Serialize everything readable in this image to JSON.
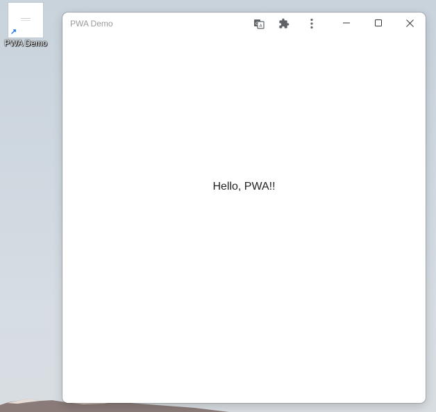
{
  "desktop": {
    "shortcut_label": "PWA Demo",
    "icon": "app-shortcut-icon"
  },
  "window": {
    "title": "PWA Demo",
    "toolbar_icons": [
      "translate-icon",
      "extensions-icon",
      "more-menu-icon"
    ],
    "controls": [
      "minimize-icon",
      "maximize-icon",
      "close-icon"
    ]
  },
  "page": {
    "heading": "Hello, PWA!!"
  }
}
